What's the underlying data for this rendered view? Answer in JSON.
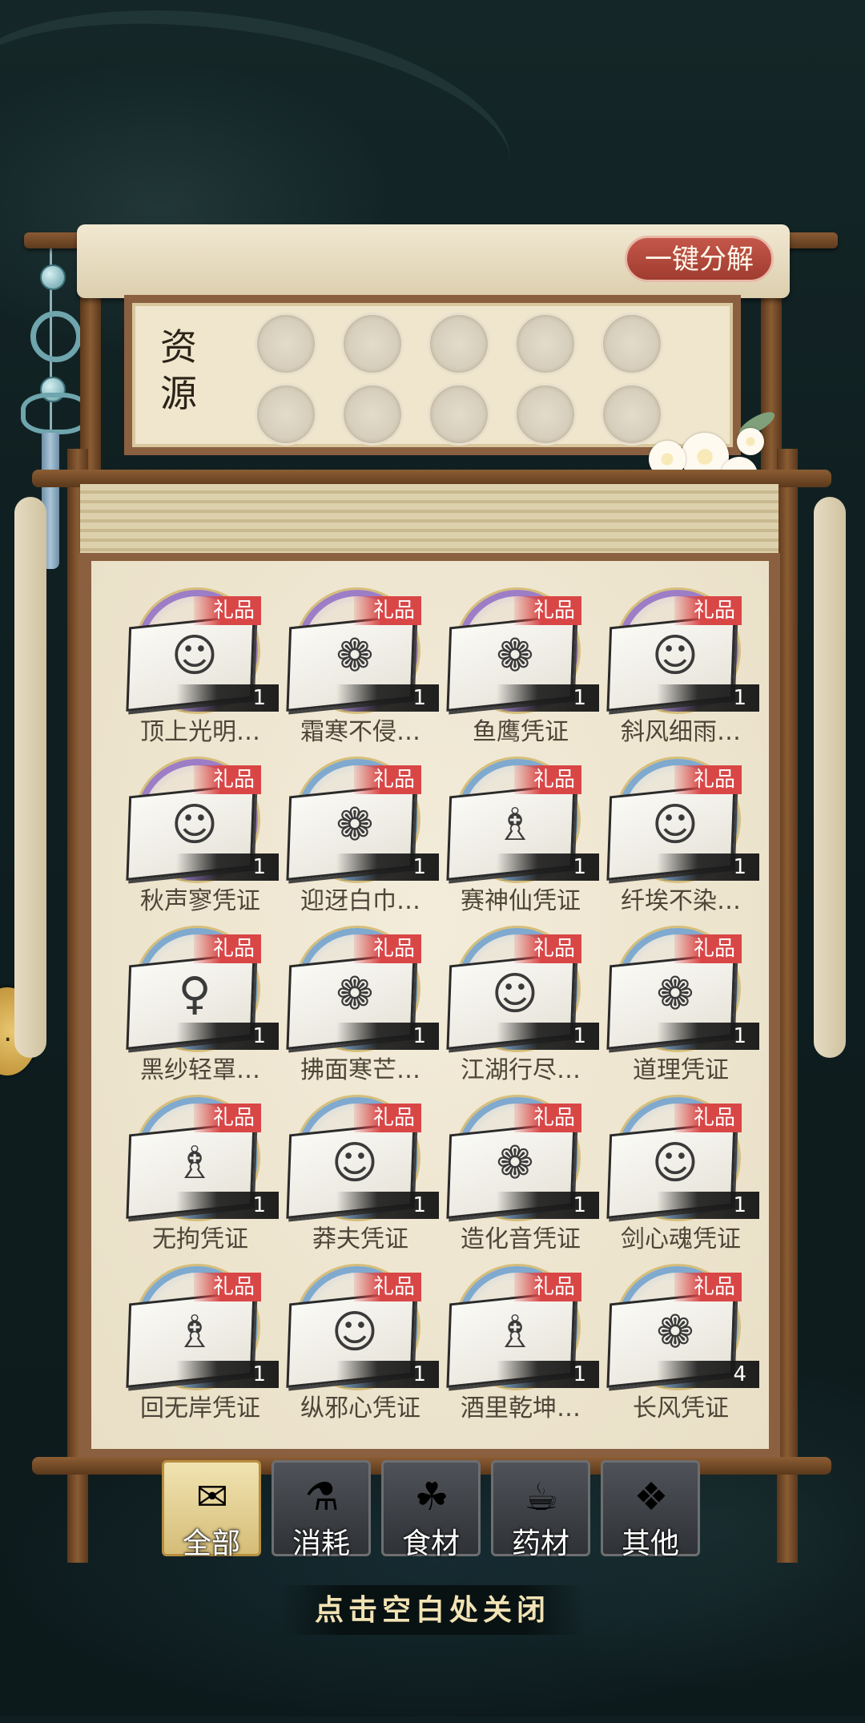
{
  "resources": {
    "label": "资源",
    "decompose_label": "一键分解",
    "slots": 10
  },
  "items": [
    {
      "name": "顶上光明…",
      "count": "1",
      "tag": "礼品",
      "ring": "purple",
      "icon": "hair-sketch-icon"
    },
    {
      "name": "霜寒不侵…",
      "count": "1",
      "tag": "礼品",
      "ring": "purple",
      "icon": "fan-sketch-icon"
    },
    {
      "name": "鱼鹰凭证",
      "count": "1",
      "tag": "礼品",
      "ring": "purple",
      "icon": "fan-sketch-icon"
    },
    {
      "name": "斜风细雨…",
      "count": "1",
      "tag": "礼品",
      "ring": "purple",
      "icon": "hair-sketch-icon"
    },
    {
      "name": "秋声寥凭证",
      "count": "1",
      "tag": "礼品",
      "ring": "purple",
      "icon": "hair-sketch-icon"
    },
    {
      "name": "迎迓白巾…",
      "count": "1",
      "tag": "礼品",
      "ring": "blue",
      "icon": "fan-sketch-icon"
    },
    {
      "name": "赛神仙凭证",
      "count": "1",
      "tag": "礼品",
      "ring": "blue",
      "icon": "robe-sketch-icon"
    },
    {
      "name": "纤埃不染…",
      "count": "1",
      "tag": "礼品",
      "ring": "blue",
      "icon": "hair-sketch-icon"
    },
    {
      "name": "黑纱轻罩…",
      "count": "1",
      "tag": "礼品",
      "ring": "blue",
      "icon": "pendant-sketch-icon"
    },
    {
      "name": "拂面寒芒…",
      "count": "1",
      "tag": "礼品",
      "ring": "blue",
      "icon": "fan-sketch-icon"
    },
    {
      "name": "江湖行尽…",
      "count": "1",
      "tag": "礼品",
      "ring": "blue",
      "icon": "hair-sketch-icon"
    },
    {
      "name": "道理凭证",
      "count": "1",
      "tag": "礼品",
      "ring": "blue",
      "icon": "fan-sketch-icon"
    },
    {
      "name": "无拘凭证",
      "count": "1",
      "tag": "礼品",
      "ring": "blue",
      "icon": "robe-sketch-icon"
    },
    {
      "name": "莽夫凭证",
      "count": "1",
      "tag": "礼品",
      "ring": "blue",
      "icon": "hair-sketch-icon"
    },
    {
      "name": "造化音凭证",
      "count": "1",
      "tag": "礼品",
      "ring": "blue",
      "icon": "fan-sketch-icon"
    },
    {
      "name": "剑心魂凭证",
      "count": "1",
      "tag": "礼品",
      "ring": "blue",
      "icon": "hair-sketch-icon"
    },
    {
      "name": "回无岸凭证",
      "count": "1",
      "tag": "礼品",
      "ring": "blue",
      "icon": "robe-sketch-icon"
    },
    {
      "name": "纵邪心凭证",
      "count": "1",
      "tag": "礼品",
      "ring": "blue",
      "icon": "hair-sketch-icon"
    },
    {
      "name": "酒里乾坤…",
      "count": "1",
      "tag": "礼品",
      "ring": "blue",
      "icon": "robe-sketch-icon"
    },
    {
      "name": "长风凭证",
      "count": "4",
      "tag": "礼品",
      "ring": "blue",
      "icon": "fan-sketch-icon"
    }
  ],
  "tabs": [
    {
      "label": "全部",
      "icon": "treasure-chest-icon",
      "active": true
    },
    {
      "label": "消耗",
      "icon": "potion-icon",
      "active": false
    },
    {
      "label": "食材",
      "icon": "vegetable-basket-icon",
      "active": false
    },
    {
      "label": "药材",
      "icon": "medicine-pot-icon",
      "active": false
    },
    {
      "label": "其他",
      "icon": "gold-ingot-icon",
      "active": false
    }
  ],
  "close_hint": "点击空白处关闭",
  "colors": {
    "rare_ring": "#9c7dc6",
    "common_ring": "#7fa9cf",
    "tag_red": "#d94646",
    "wood": "#8a6040",
    "parchment": "#efe6cd"
  }
}
